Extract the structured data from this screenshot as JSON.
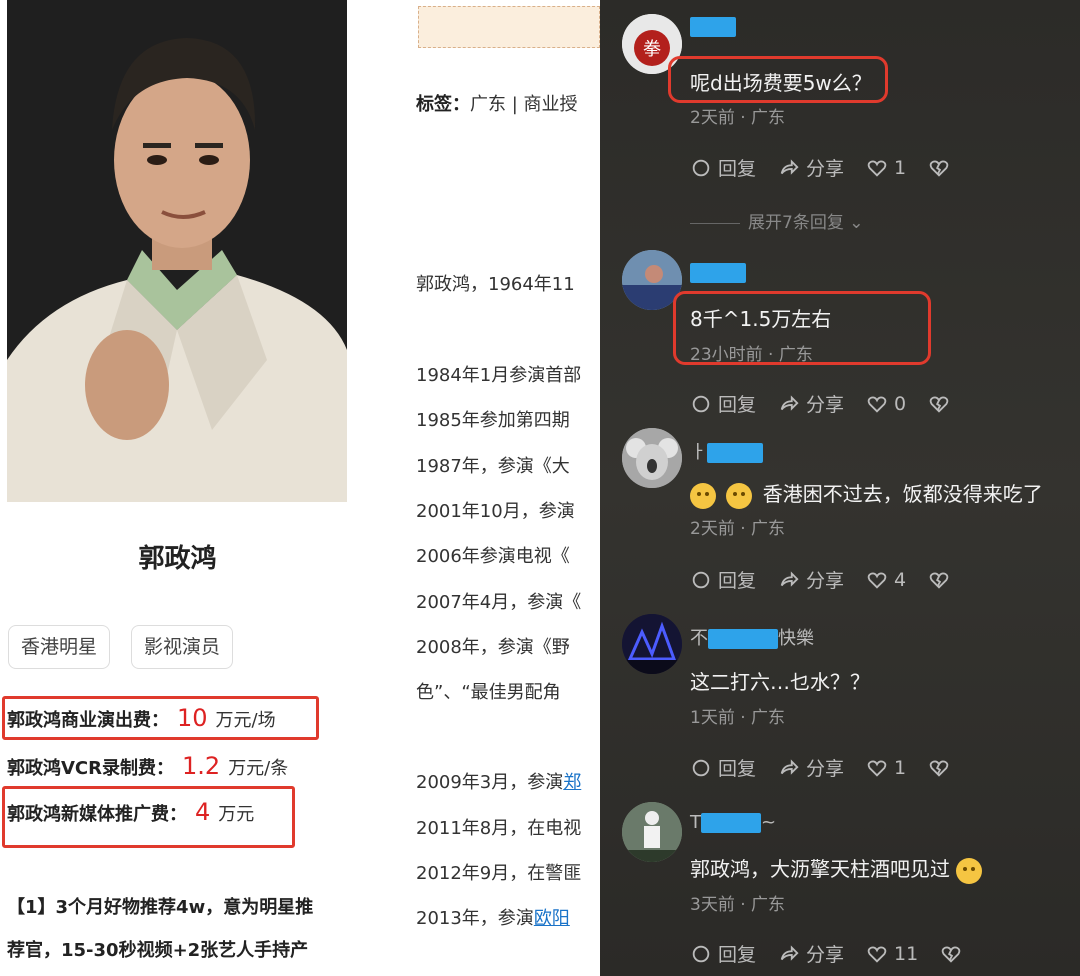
{
  "left": {
    "name": "郭政鸿",
    "tags": [
      "香港明星",
      "影视演员"
    ],
    "fees": [
      {
        "label": "郭政鸿商业演出费：",
        "value": "10",
        "unit": "万元/场"
      },
      {
        "label": "郭政鸿VCR录制费：",
        "value": "1.2",
        "unit": "万元/条"
      },
      {
        "label": "郭政鸿新媒体推广费：",
        "value": "4",
        "unit": "万元"
      }
    ],
    "note_line1": "【1】3个月好物推荐4w，意为明星推",
    "note_line2": "荐官，15-30秒视频+2张艺人手持产"
  },
  "middle": {
    "tags_label": "标签：",
    "tags_value": "广东 | 商业授",
    "bio": "郭政鸿，1964年11",
    "timeline": [
      "1984年1月参演首部",
      "1985年参加第四期",
      "1987年，参演《大",
      "2001年10月，参演",
      "2006年参演电视《",
      "2007年4月，参演《",
      "2008年，参演《野",
      "色”、“最佳男配角"
    ],
    "t2009_prefix": "2009年3月，参演",
    "t2009_link": "郑",
    "t2011": "2011年8月，在电视",
    "t2012": "2012年9月，在警匪",
    "t2013_prefix": "2013年，参演",
    "t2013_link": "欧阳"
  },
  "comments": [
    {
      "name": "",
      "text": "呢d出场费要5w么？",
      "meta": "2天前 · 广东",
      "reply": "回复",
      "share": "分享",
      "likes": "1"
    },
    {
      "name": "",
      "text": "8千^1.5万左右",
      "meta": "23小时前 · 广东",
      "reply": "回复",
      "share": "分享",
      "likes": "0"
    },
    {
      "name": "",
      "text": "香港困不过去，饭都没得来吃了",
      "meta": "2天前 · 广东",
      "reply": "回复",
      "share": "分享",
      "likes": "4"
    },
    {
      "name_prefix": "不",
      "name_suffix": "快樂",
      "text": "这二打六…乜水？？",
      "meta": "1天前 · 广东",
      "reply": "回复",
      "share": "分享",
      "likes": "1"
    },
    {
      "name_prefix": "T",
      "name_suffix": "~",
      "text": "郭政鸿，大沥擎天柱酒吧见过",
      "meta": "3天前 · 广东",
      "reply": "回复",
      "share": "分享",
      "likes": "11"
    }
  ],
  "expand_label": "展开7条回复",
  "colors": {
    "highlight_red": "#e03a2d",
    "fee_red": "#d22",
    "link_blue": "#1a73c8"
  }
}
